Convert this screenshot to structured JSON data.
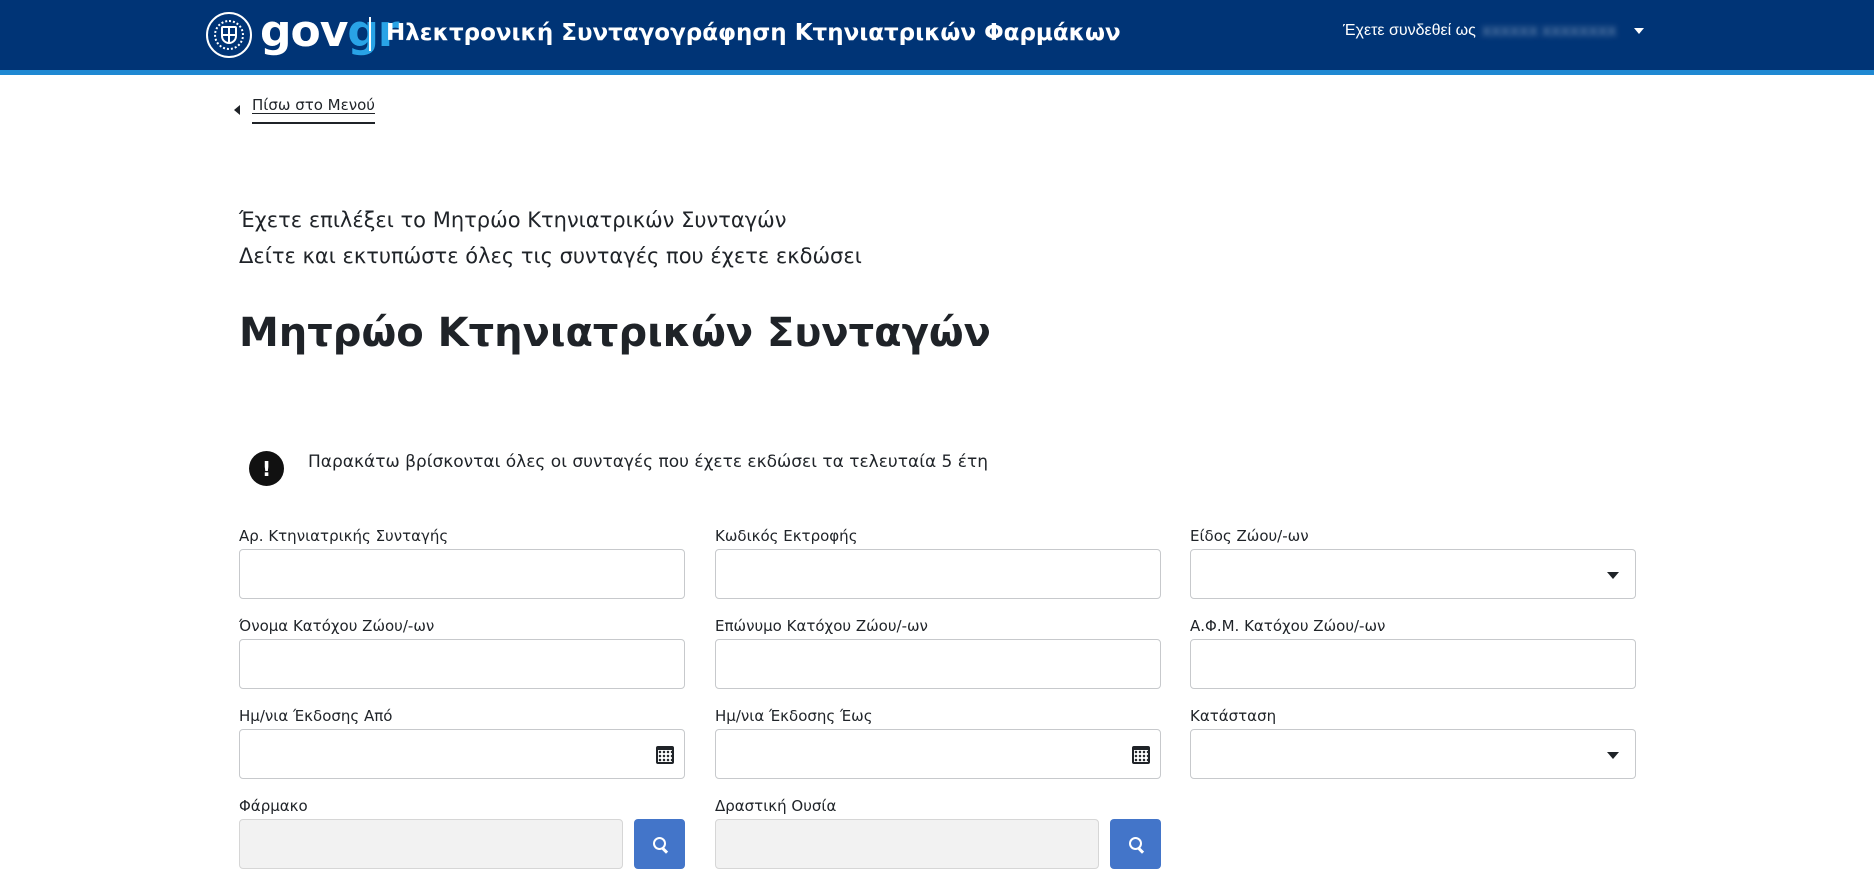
{
  "header": {
    "logo": {
      "part1": "gov",
      "part2": "gr"
    },
    "app_title": "Ηλεκτρονική Συνταγογράφηση Κτηνιατρικών Φαρμάκων",
    "user": {
      "prefix": "Έχετε συνδεθεί ως",
      "name": "ΧΧΧΧΧΧ ΧΧΧΧΧΧΧΧ"
    },
    "colors": {
      "bar": "#003476",
      "stripe": "#1f88d2",
      "accent": "#29a3e6"
    }
  },
  "back_link": {
    "label": "Πίσω στο Μενού"
  },
  "intro": {
    "line1": "Έχετε επιλέξει το Μητρώο Κτηνιατρικών Συνταγών",
    "line2": "Δείτε και εκτυπώστε όλες τις συνταγές που έχετε εκδώσει"
  },
  "page_title": "Μητρώο Κτηνιατρικών Συνταγών",
  "notice": {
    "icon": "exclamation-icon",
    "text": "Παρακάτω βρίσκονται όλες οι συνταγές που έχετε εκδώσει τα τελευταία 5 έτη"
  },
  "form": {
    "prescription_number": {
      "label": "Αρ. Κτηνιατρικής Συνταγής",
      "value": ""
    },
    "farm_code": {
      "label": "Κωδικός Εκτροφής",
      "value": ""
    },
    "animal_type": {
      "label": "Είδος Ζώου/-ων",
      "value": ""
    },
    "owner_first_name": {
      "label": "Όνομα Κατόχου Ζώου/-ων",
      "value": ""
    },
    "owner_last_name": {
      "label": "Επώνυμο Κατόχου Ζώου/-ων",
      "value": ""
    },
    "owner_afm": {
      "label": "Α.Φ.Μ. Κατόχου Ζώου/-ων",
      "value": ""
    },
    "issue_date_from": {
      "label": "Ημ/νια Έκδοσης Από",
      "value": ""
    },
    "issue_date_to": {
      "label": "Ημ/νια Έκδοσης Έως",
      "value": ""
    },
    "status": {
      "label": "Κατάσταση",
      "value": ""
    },
    "drug": {
      "label": "Φάρμακο",
      "value": ""
    },
    "active_substance": {
      "label": "Δραστική Ουσία",
      "value": ""
    }
  }
}
